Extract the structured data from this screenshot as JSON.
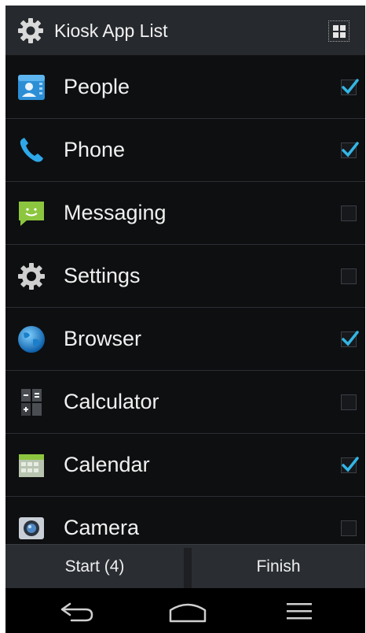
{
  "header": {
    "title": "Kiosk App List",
    "icon": "gear-icon",
    "menu_icon": "grid-icon"
  },
  "apps": [
    {
      "label": "People",
      "icon": "people-icon",
      "checked": true
    },
    {
      "label": "Phone",
      "icon": "phone-icon",
      "checked": true
    },
    {
      "label": "Messaging",
      "icon": "messaging-icon",
      "checked": false
    },
    {
      "label": "Settings",
      "icon": "settings-icon",
      "checked": false
    },
    {
      "label": "Browser",
      "icon": "browser-icon",
      "checked": true
    },
    {
      "label": "Calculator",
      "icon": "calculator-icon",
      "checked": false
    },
    {
      "label": "Calendar",
      "icon": "calendar-icon",
      "checked": true
    },
    {
      "label": "Camera",
      "icon": "camera-icon",
      "checked": false
    }
  ],
  "actions": {
    "start_label": "Start (4)",
    "finish_label": "Finish"
  },
  "navbar": {
    "back": "back-icon",
    "home": "home-icon",
    "recents": "recents-icon"
  },
  "colors": {
    "checkmark": "#33b5e5",
    "titlebar": "#26292d",
    "background": "#0e0f11",
    "actionbar": "#2a2d32"
  }
}
